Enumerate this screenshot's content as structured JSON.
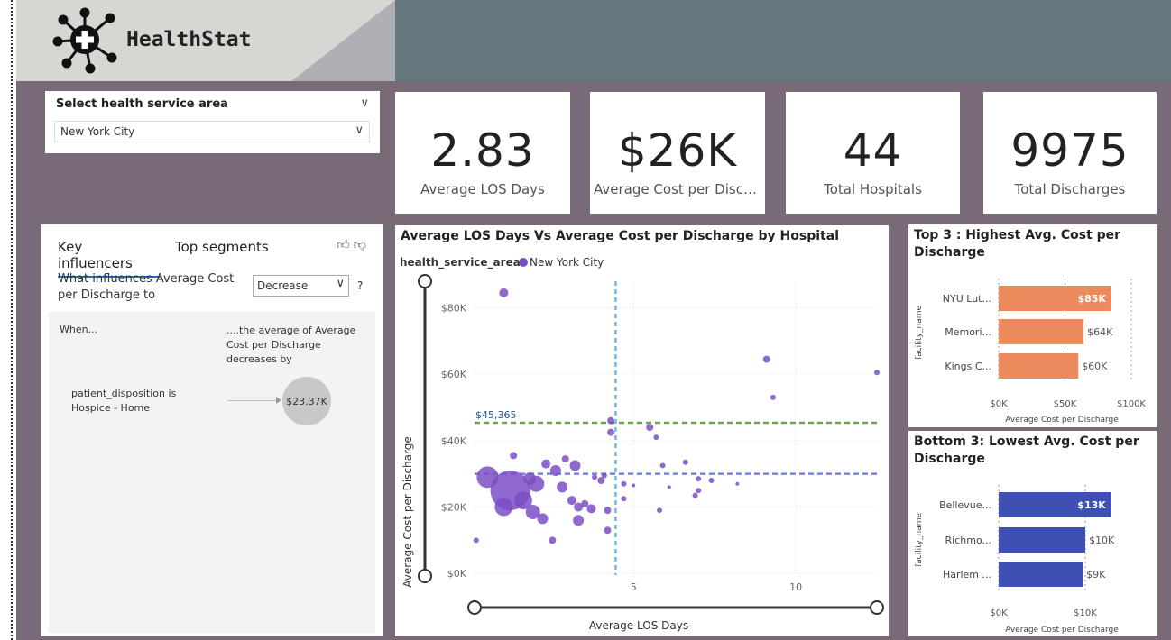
{
  "app": {
    "title": "HealthStat"
  },
  "colors": {
    "canvas": "#786a77",
    "header": "#64777d",
    "scatter": "#7b4fc4",
    "top_bar": "#ec8a5d",
    "bottom_bar": "#3e50b4"
  },
  "slicer": {
    "label": "Select health service area",
    "value": "New York City"
  },
  "kpis": [
    {
      "value": "2.83",
      "label": "Average LOS Days"
    },
    {
      "value": "$26K",
      "label": "Average Cost per Disch..."
    },
    {
      "value": "44",
      "label": "Total Hospitals"
    },
    {
      "value": "9975",
      "label": "Total Discharges"
    }
  ],
  "key_influencers": {
    "tabs": [
      "Key influencers",
      "Top segments"
    ],
    "question": "What influences Average Cost per Discharge to",
    "dropdown_value": "Decrease",
    "help": "?",
    "when_label": "When...",
    "then_label": "....the average of Average Cost per Discharge decreases by",
    "condition": "patient_disposition is Hospice - Home",
    "effect": "$23.37K"
  },
  "chart_data": [
    {
      "type": "scatter",
      "title": "Average LOS Days Vs Average Cost per Discharge by Hospital",
      "legend_title": "health_service_area",
      "legend": [
        "New York City"
      ],
      "xlabel": "Average LOS Days",
      "ylabel": "Average Cost per Discharge",
      "xticks": [
        "5",
        "10"
      ],
      "yticks": [
        "$0K",
        "$20K",
        "$40K",
        "$60K",
        "$80K"
      ],
      "xlim": [
        0.1,
        12.5
      ],
      "ylim": [
        -500,
        88000
      ],
      "reference_label": "$45,365",
      "ref_x_value": 4.45,
      "ref_y_green": 45365,
      "ref_y_blue": 30000,
      "points": [
        {
          "x": 1.0,
          "y": 84500,
          "s": 5
        },
        {
          "x": 9.1,
          "y": 64500,
          "s": 4
        },
        {
          "x": 9.3,
          "y": 53000,
          "s": 3
        },
        {
          "x": 12.5,
          "y": 60500,
          "s": 3
        },
        {
          "x": 4.3,
          "y": 46000,
          "s": 4
        },
        {
          "x": 4.3,
          "y": 42500,
          "s": 4
        },
        {
          "x": 5.5,
          "y": 44000,
          "s": 4
        },
        {
          "x": 5.7,
          "y": 41000,
          "s": 3
        },
        {
          "x": 5.9,
          "y": 32500,
          "s": 3
        },
        {
          "x": 6.6,
          "y": 33500,
          "s": 3
        },
        {
          "x": 6.1,
          "y": 26000,
          "s": 2
        },
        {
          "x": 7.0,
          "y": 28500,
          "s": 3
        },
        {
          "x": 7.0,
          "y": 25000,
          "s": 3
        },
        {
          "x": 6.9,
          "y": 23500,
          "s": 3
        },
        {
          "x": 7.4,
          "y": 28000,
          "s": 3
        },
        {
          "x": 8.2,
          "y": 27000,
          "s": 2
        },
        {
          "x": 4.7,
          "y": 27000,
          "s": 3
        },
        {
          "x": 5.0,
          "y": 26500,
          "s": 2
        },
        {
          "x": 5.8,
          "y": 19000,
          "s": 3
        },
        {
          "x": 4.7,
          "y": 22500,
          "s": 3
        },
        {
          "x": 4.1,
          "y": 29500,
          "s": 3
        },
        {
          "x": 4.0,
          "y": 28000,
          "s": 4
        },
        {
          "x": 3.8,
          "y": 29000,
          "s": 3
        },
        {
          "x": 3.5,
          "y": 21000,
          "s": 4
        },
        {
          "x": 3.7,
          "y": 19500,
          "s": 5
        },
        {
          "x": 4.2,
          "y": 19000,
          "s": 4
        },
        {
          "x": 4.2,
          "y": 13000,
          "s": 4
        },
        {
          "x": 3.3,
          "y": 20000,
          "s": 5
        },
        {
          "x": 3.1,
          "y": 22000,
          "s": 5
        },
        {
          "x": 2.8,
          "y": 26000,
          "s": 6
        },
        {
          "x": 3.2,
          "y": 32500,
          "s": 6
        },
        {
          "x": 2.9,
          "y": 34500,
          "s": 4
        },
        {
          "x": 2.6,
          "y": 31000,
          "s": 6
        },
        {
          "x": 2.3,
          "y": 33000,
          "s": 5
        },
        {
          "x": 0.5,
          "y": 29000,
          "s": 12
        },
        {
          "x": 1.2,
          "y": 25000,
          "s": 22
        },
        {
          "x": 1.0,
          "y": 20000,
          "s": 10
        },
        {
          "x": 1.6,
          "y": 22000,
          "s": 10
        },
        {
          "x": 2.0,
          "y": 27000,
          "s": 9
        },
        {
          "x": 2.2,
          "y": 16500,
          "s": 6
        },
        {
          "x": 1.8,
          "y": 28500,
          "s": 7
        },
        {
          "x": 3.3,
          "y": 16000,
          "s": 6
        },
        {
          "x": 2.5,
          "y": 10000,
          "s": 4
        },
        {
          "x": 1.3,
          "y": 35500,
          "s": 4
        },
        {
          "x": 1.9,
          "y": 18500,
          "s": 8
        },
        {
          "x": 0.15,
          "y": 10000,
          "s": 3
        }
      ]
    },
    {
      "type": "bar",
      "title": "Top 3 : Highest Avg. Cost per Discharge",
      "categories": [
        "NYU Lut...",
        "Memori...",
        "Kings C..."
      ],
      "values": [
        85000,
        64000,
        60000
      ],
      "labels": [
        "$85K",
        "$64K",
        "$60K"
      ],
      "xlabel": "Average Cost per Discharge",
      "ylabel": "facility_name",
      "xticks": [
        "$0K",
        "$50K",
        "$100K"
      ],
      "xlim": [
        0,
        100000
      ]
    },
    {
      "type": "bar",
      "title": "Bottom 3: Lowest Avg. Cost per Discharge",
      "categories": [
        "Bellevue...",
        "Richmo...",
        "Harlem ..."
      ],
      "values": [
        13000,
        10000,
        9700
      ],
      "labels": [
        "$13K",
        "$10K",
        "$9K"
      ],
      "xlabel": "Average Cost per Discharge",
      "ylabel": "facility_name",
      "xticks": [
        "$0K",
        "$10K"
      ],
      "xlim": [
        0,
        10000
      ]
    }
  ]
}
